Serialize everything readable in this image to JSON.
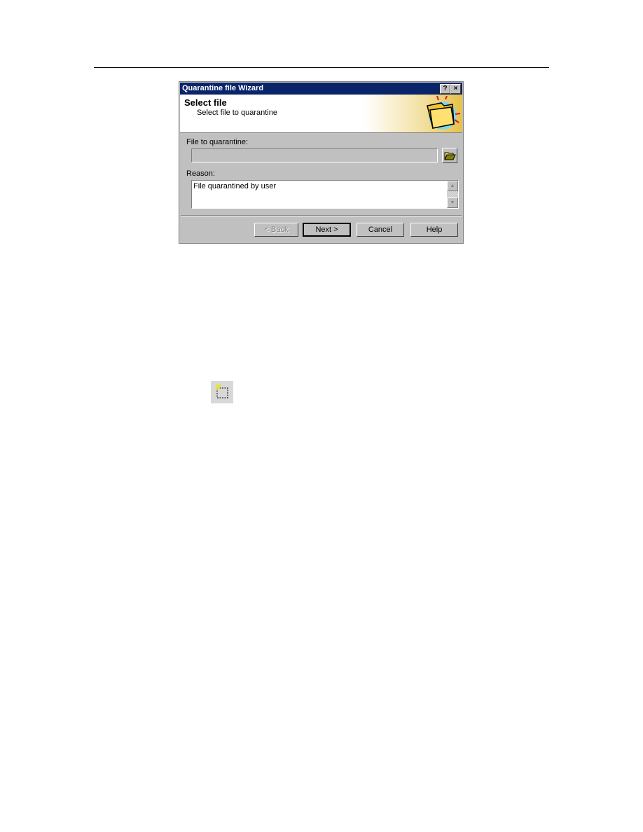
{
  "dialog": {
    "title": "Quarantine file Wizard",
    "help_button": "?",
    "close_button": "×",
    "header": {
      "title": "Select file",
      "subtitle": "Select file to quarantine",
      "icon": "folder-icon"
    },
    "file_label": "File to quarantine:",
    "file_value": "",
    "browse_icon": "open-folder-icon",
    "reason_label": "Reason:",
    "reason_value": "File quarantined by user",
    "buttons": {
      "back": "< Back",
      "next": "Next >",
      "cancel": "Cancel",
      "help": "Help"
    }
  },
  "toolbar_icon": "quarantine-toolbar-icon"
}
